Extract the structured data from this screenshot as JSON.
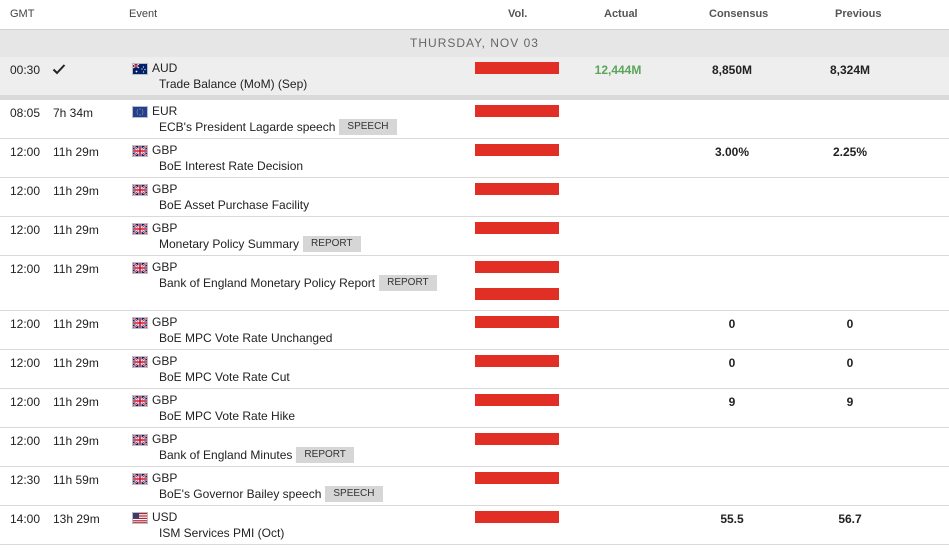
{
  "header": {
    "gmt": "GMT",
    "event": "Event",
    "vol": "Vol.",
    "actual": "Actual",
    "consensus": "Consensus",
    "previous": "Previous"
  },
  "day_label": "THURSDAY, NOV 03",
  "colors": {
    "volatility_bar": "#e22f26",
    "actual_positive": "#5aa55a",
    "tag_bg": "#d6d6d6",
    "day_bar_bg": "#e6e6e6"
  },
  "events": [
    {
      "time": "00:30",
      "countdown": "",
      "released": true,
      "flag": "flag-au",
      "currency": "AUD",
      "name": "Trade Balance (MoM) (Sep)",
      "tag": "",
      "actual": "12,444M",
      "consensus": "8,850M",
      "previous": "8,324M"
    },
    {
      "time": "08:05",
      "countdown": "7h 34m",
      "released": false,
      "flag": "flag-eu",
      "currency": "EUR",
      "name": "ECB's President Lagarde speech",
      "tag": "SPEECH",
      "actual": "",
      "consensus": "",
      "previous": ""
    },
    {
      "time": "12:00",
      "countdown": "11h 29m",
      "released": false,
      "flag": "flag-gb",
      "currency": "GBP",
      "name": "BoE Interest Rate Decision",
      "tag": "",
      "actual": "",
      "consensus": "3.00%",
      "previous": "2.25%"
    },
    {
      "time": "12:00",
      "countdown": "11h 29m",
      "released": false,
      "flag": "flag-gb",
      "currency": "GBP",
      "name": "BoE Asset Purchase Facility",
      "tag": "",
      "actual": "",
      "consensus": "",
      "previous": ""
    },
    {
      "time": "12:00",
      "countdown": "11h 29m",
      "released": false,
      "flag": "flag-gb",
      "currency": "GBP",
      "name": "Monetary Policy Summary",
      "tag": "REPORT",
      "actual": "",
      "consensus": "",
      "previous": ""
    },
    {
      "time": "12:00",
      "countdown": "11h 29m",
      "released": false,
      "flag": "flag-gb",
      "currency": "GBP",
      "name": "Bank of England Monetary Policy Report",
      "tag": "REPORT",
      "actual": "",
      "consensus": "",
      "previous": ""
    },
    {
      "time": "12:00",
      "countdown": "11h 29m",
      "released": false,
      "flag": "flag-gb",
      "currency": "GBP",
      "name": "BoE MPC Vote Rate Unchanged",
      "tag": "",
      "actual": "",
      "consensus": "0",
      "previous": "0"
    },
    {
      "time": "12:00",
      "countdown": "11h 29m",
      "released": false,
      "flag": "flag-gb",
      "currency": "GBP",
      "name": "BoE MPC Vote Rate Cut",
      "tag": "",
      "actual": "",
      "consensus": "0",
      "previous": "0"
    },
    {
      "time": "12:00",
      "countdown": "11h 29m",
      "released": false,
      "flag": "flag-gb",
      "currency": "GBP",
      "name": "BoE MPC Vote Rate Hike",
      "tag": "",
      "actual": "",
      "consensus": "9",
      "previous": "9"
    },
    {
      "time": "12:00",
      "countdown": "11h 29m",
      "released": false,
      "flag": "flag-gb",
      "currency": "GBP",
      "name": "Bank of England Minutes",
      "tag": "REPORT",
      "actual": "",
      "consensus": "",
      "previous": ""
    },
    {
      "time": "12:30",
      "countdown": "11h 59m",
      "released": false,
      "flag": "flag-gb",
      "currency": "GBP",
      "name": "BoE's Governor Bailey speech",
      "tag": "SPEECH",
      "actual": "",
      "consensus": "",
      "previous": ""
    },
    {
      "time": "14:00",
      "countdown": "13h 29m",
      "released": false,
      "flag": "flag-us",
      "currency": "USD",
      "name": "ISM Services PMI (Oct)",
      "tag": "",
      "actual": "",
      "consensus": "55.5",
      "previous": "56.7"
    }
  ]
}
